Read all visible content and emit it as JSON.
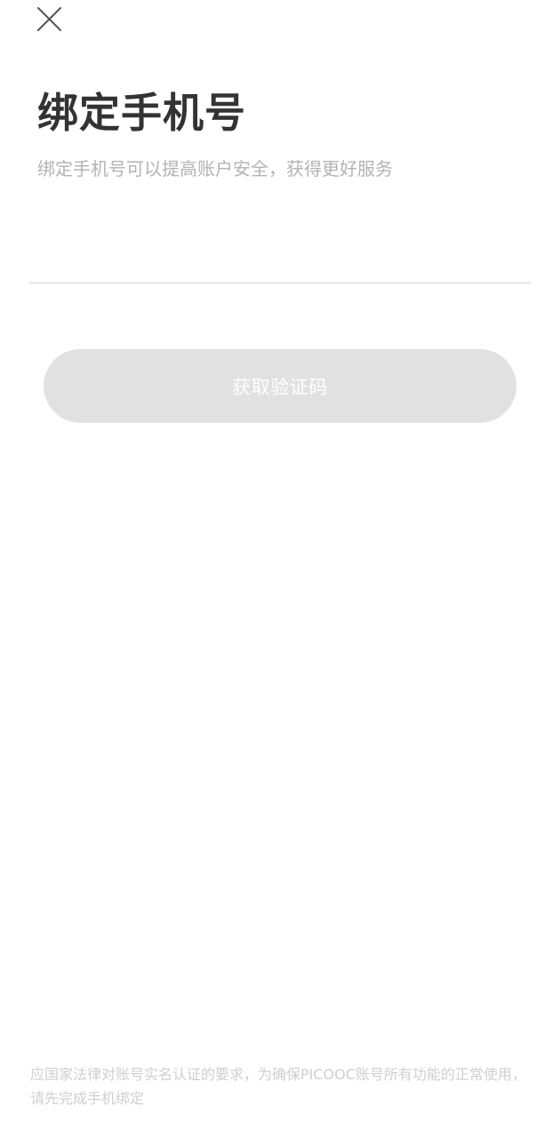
{
  "header": {
    "close_icon": "close-icon"
  },
  "page": {
    "title": "绑定手机号",
    "subtitle": "绑定手机号可以提高账户安全，获得更好服务"
  },
  "phone_input": {
    "value": "",
    "placeholder": ""
  },
  "actions": {
    "get_code_label": "获取验证码"
  },
  "footer": {
    "notice": "应国家法律对账号实名认证的要求，为确保PICOOC账号所有功能的正常使用，请先完成手机绑定"
  },
  "colors": {
    "title": "#333333",
    "subtitle": "#b3b3b3",
    "button_disabled_bg": "#e1e1e1",
    "button_text": "#ffffff",
    "divider": "#d6d6d6",
    "footer_text": "#cfcfcf"
  }
}
